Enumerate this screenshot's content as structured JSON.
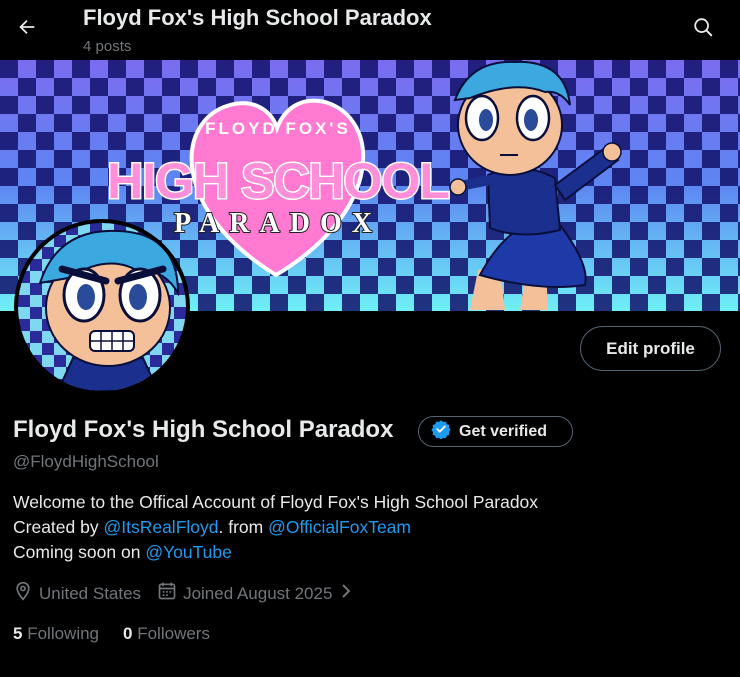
{
  "header": {
    "title": "Floyd Fox's High School Paradox",
    "post_count": "4 posts"
  },
  "banner": {
    "logo_top": "FLOYD FOX'S",
    "logo_main": "HIGH SCHOOL",
    "logo_bottom": "PARADOX"
  },
  "profile": {
    "edit_label": "Edit profile",
    "name": "Floyd Fox's High School Paradox",
    "verify_label": "Get verified",
    "handle": "@FloydHighSchool",
    "bio": {
      "line1": "Welcome to the Offical Account of Floyd Fox's High School Paradox",
      "line2_prefix": "Created by ",
      "line2_link1": "@ItsRealFloyd",
      "line2_middle": ". from ",
      "line2_link2": "@OfficialFoxTeam",
      "line3_prefix": "Coming soon on ",
      "line3_link": "@YouTube"
    },
    "location": "United States",
    "joined": "Joined August 2025",
    "following_count": "5",
    "following_label": "Following",
    "followers_count": "0",
    "followers_label": "Followers"
  },
  "colors": {
    "link": "#1d9bf0",
    "muted": "#71767b",
    "verified_badge": "#1d9bf0",
    "logo_pink": "#ff6ec7"
  },
  "icons": {
    "back": "arrow-left-icon",
    "search": "search-icon",
    "verified": "verified-badge-icon",
    "location": "location-pin-icon",
    "calendar": "calendar-icon",
    "chevron": "chevron-right-icon"
  }
}
